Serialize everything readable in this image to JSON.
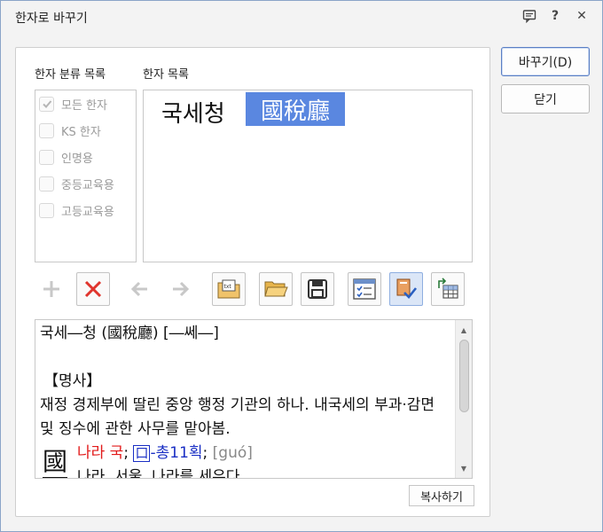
{
  "window": {
    "title": "한자로 바꾸기"
  },
  "titlebar": {
    "comment_icon": "comment-icon",
    "help_label": "?",
    "close_label": "✕"
  },
  "categories": {
    "label": "한자 분류 목록",
    "items": [
      {
        "label": "모든 한자",
        "checked": true
      },
      {
        "label": "KS 한자",
        "checked": false
      },
      {
        "label": "인명용",
        "checked": false
      },
      {
        "label": "중등교육용",
        "checked": false
      },
      {
        "label": "고등교육용",
        "checked": false
      }
    ]
  },
  "hanja_list": {
    "label": "한자 목록",
    "hangul": "국세청",
    "selected_hanja": "國稅廳"
  },
  "toolbar": {
    "icons": [
      "add-icon",
      "delete-icon",
      "arrow-left-icon",
      "arrow-right-icon",
      "dictionary-file-icon",
      "open-folder-icon",
      "save-icon",
      "checklist-icon",
      "book-check-icon",
      "convert-table-icon"
    ]
  },
  "dictionary": {
    "headword": "국세―청 (國稅廳) [―쎄―]",
    "pos": "【명사】",
    "definition": "재정 경제부에 딸린 중앙 행정 기관의 하나. 내국세의 부과·감면 및 징수에 관한 사무를 맡아봄.",
    "char_big": "國",
    "char_meaning": "나라 국",
    "sep1": ";",
    "radical_box": "口",
    "radical_strokes": "-총11획",
    "sep2": ";",
    "pinyin": "[guó]",
    "next_line": "나라, 서울, 나라를 세우다"
  },
  "buttons": {
    "copy": "복사하기",
    "convert": "바꾸기(D)",
    "close": "닫기"
  },
  "colors": {
    "accent": "#5a87e0",
    "meaning": "#e21a1a",
    "radical": "#1a2fc4"
  }
}
